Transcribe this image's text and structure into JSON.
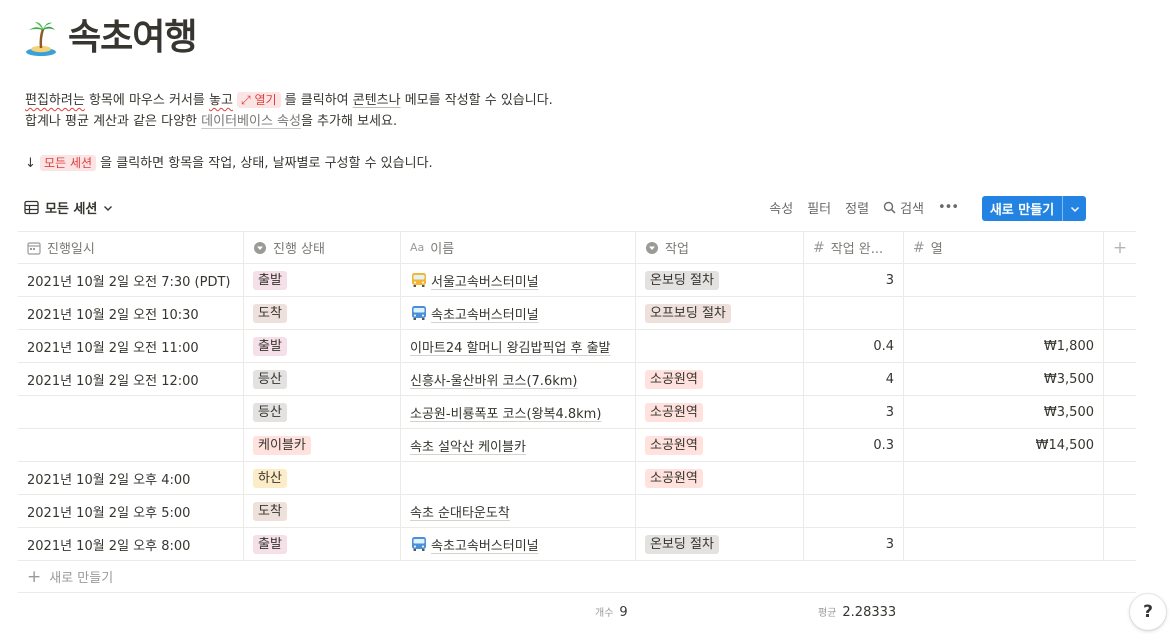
{
  "page": {
    "title": "속초여행",
    "emoji": "island-icon"
  },
  "description": {
    "line1_a": "편집하려는",
    "line1_b": " 항목에 마우스 커서를 ",
    "line1_c": "놓고",
    "line1_open": "⤢ 열기",
    "line1_d": " 를 클릭하여 ",
    "line1_e": "콘텐츠나",
    "line1_f": " 메모를 작성할 수 있습니다.",
    "line2_a": "합계나 평균 계산과 같은 다양한 ",
    "line2_link": "데이터베이스 속성",
    "line2_b": "을 추가해 보세요.",
    "line3_arrow": "↓",
    "line3_chip": "모든 세션",
    "line3_b": " 을 클릭하면 항목을 작업, 상태, 날짜별로 구성할 수 있습니다."
  },
  "view": {
    "tab_label": "모든 세션",
    "properties": "속성",
    "filter": "필터",
    "sort": "정렬",
    "search": "검색",
    "more": "•••",
    "new_button": "새로 만들기"
  },
  "columns": [
    "진행일시",
    "진행 상태",
    "이름",
    "작업",
    "작업 완...",
    "열"
  ],
  "colors": {
    "accent": "#2383e2",
    "status": {
      "출발": "#f5e0e9",
      "도착": "#eee0da",
      "등산": "#e3e2e0",
      "케이블카": "#ffe2dd",
      "하산": "#fdecc8"
    },
    "task": {
      "온보딩 절차": "#e3e2e0",
      "오프보딩 절차": "#eee0da",
      "소공원역": "#ffe2dd"
    }
  },
  "rows": [
    {
      "date": "2021년 10월 2일 오전 7:30 (PDT)",
      "status": "출발",
      "name": "서울고속버스터미널",
      "bus": "yellow",
      "task": "온보딩 절차",
      "done": "3",
      "col": ""
    },
    {
      "date": "2021년 10월 2일 오전 10:30",
      "status": "도착",
      "name": "속초고속버스터미널",
      "bus": "blue",
      "task": "오프보딩 절차",
      "done": "",
      "col": ""
    },
    {
      "date": "2021년 10월 2일 오전 11:00",
      "status": "출발",
      "name": "이마트24 할머니 왕김밥픽업 후 출발",
      "bus": "",
      "task": "",
      "done": "0.4",
      "col": "₩1,800"
    },
    {
      "date": "2021년 10월 2일 오전 12:00",
      "status": "등산",
      "name": "신흥사-울산바위 코스(7.6km)",
      "bus": "",
      "task": "소공원역",
      "done": "4",
      "col": "₩3,500"
    },
    {
      "date": "",
      "status": "등산",
      "name": "소공원-비룡폭포 코스(왕복4.8km)",
      "bus": "",
      "task": "소공원역",
      "done": "3",
      "col": "₩3,500"
    },
    {
      "date": "",
      "status": "케이블카",
      "name": "속초 설악산 케이블카",
      "bus": "",
      "task": "소공원역",
      "done": "0.3",
      "col": "₩14,500"
    },
    {
      "date": "2021년 10월 2일 오후 4:00",
      "status": "하산",
      "name": "",
      "bus": "",
      "task": "소공원역",
      "done": "",
      "col": ""
    },
    {
      "date": "2021년 10월 2일 오후 5:00",
      "status": "도착",
      "name": "속초 순대타운도착",
      "bus": "",
      "task": "",
      "done": "",
      "col": ""
    },
    {
      "date": "2021년 10월 2일 오후 8:00",
      "status": "출발",
      "name": "속초고속버스터미널",
      "bus": "blue",
      "task": "온보딩 절차",
      "done": "3",
      "col": ""
    }
  ],
  "new_row_label": "새로 만들기",
  "footer": {
    "count_label": "개수",
    "count_value": "9",
    "avg_label": "평균",
    "avg_value": "2.28333"
  },
  "help_label": "?"
}
